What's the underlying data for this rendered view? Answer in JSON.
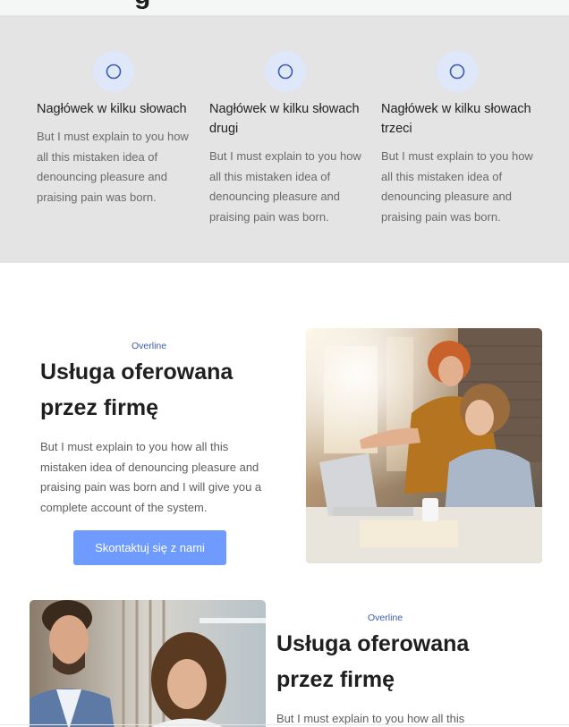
{
  "top_section": {
    "clipped_heading": "g"
  },
  "features": [
    {
      "title": "Nagłówek w kilku słowach",
      "text": "But I must explain to you how all this mistaken idea of denouncing pleasure and praising pain was born.",
      "icon": "circle-icon"
    },
    {
      "title": "Nagłówek w kilku słowach drugi",
      "text": "But I must explain to you how all this mistaken idea of denouncing pleasure and praising pain was born.",
      "icon": "circle-icon"
    },
    {
      "title": "Nagłówek w kilku słowach trzeci",
      "text": "But I must explain to you how all this mistaken idea of denouncing pleasure and praising pain was born.",
      "icon": "circle-icon"
    }
  ],
  "service_1": {
    "overline": "Overline",
    "title": "Usługa oferowana przez firmę",
    "text": "But I must explain to you how all this mistaken idea of denouncing pleasure and praising pain was born and I will give you a complete account of the system.",
    "button_label": "Skontaktuj się z nami"
  },
  "service_2": {
    "overline": "Overline",
    "title": "Usługa oferowana przez firmę",
    "text": "But I must explain to you how all this"
  },
  "colors": {
    "feature_band": "#e5e4e4",
    "icon_bg": "#dfe7fb",
    "icon_stroke": "#3a5bb0",
    "overline": "#3a5bb0",
    "button": "#6f9bff"
  }
}
